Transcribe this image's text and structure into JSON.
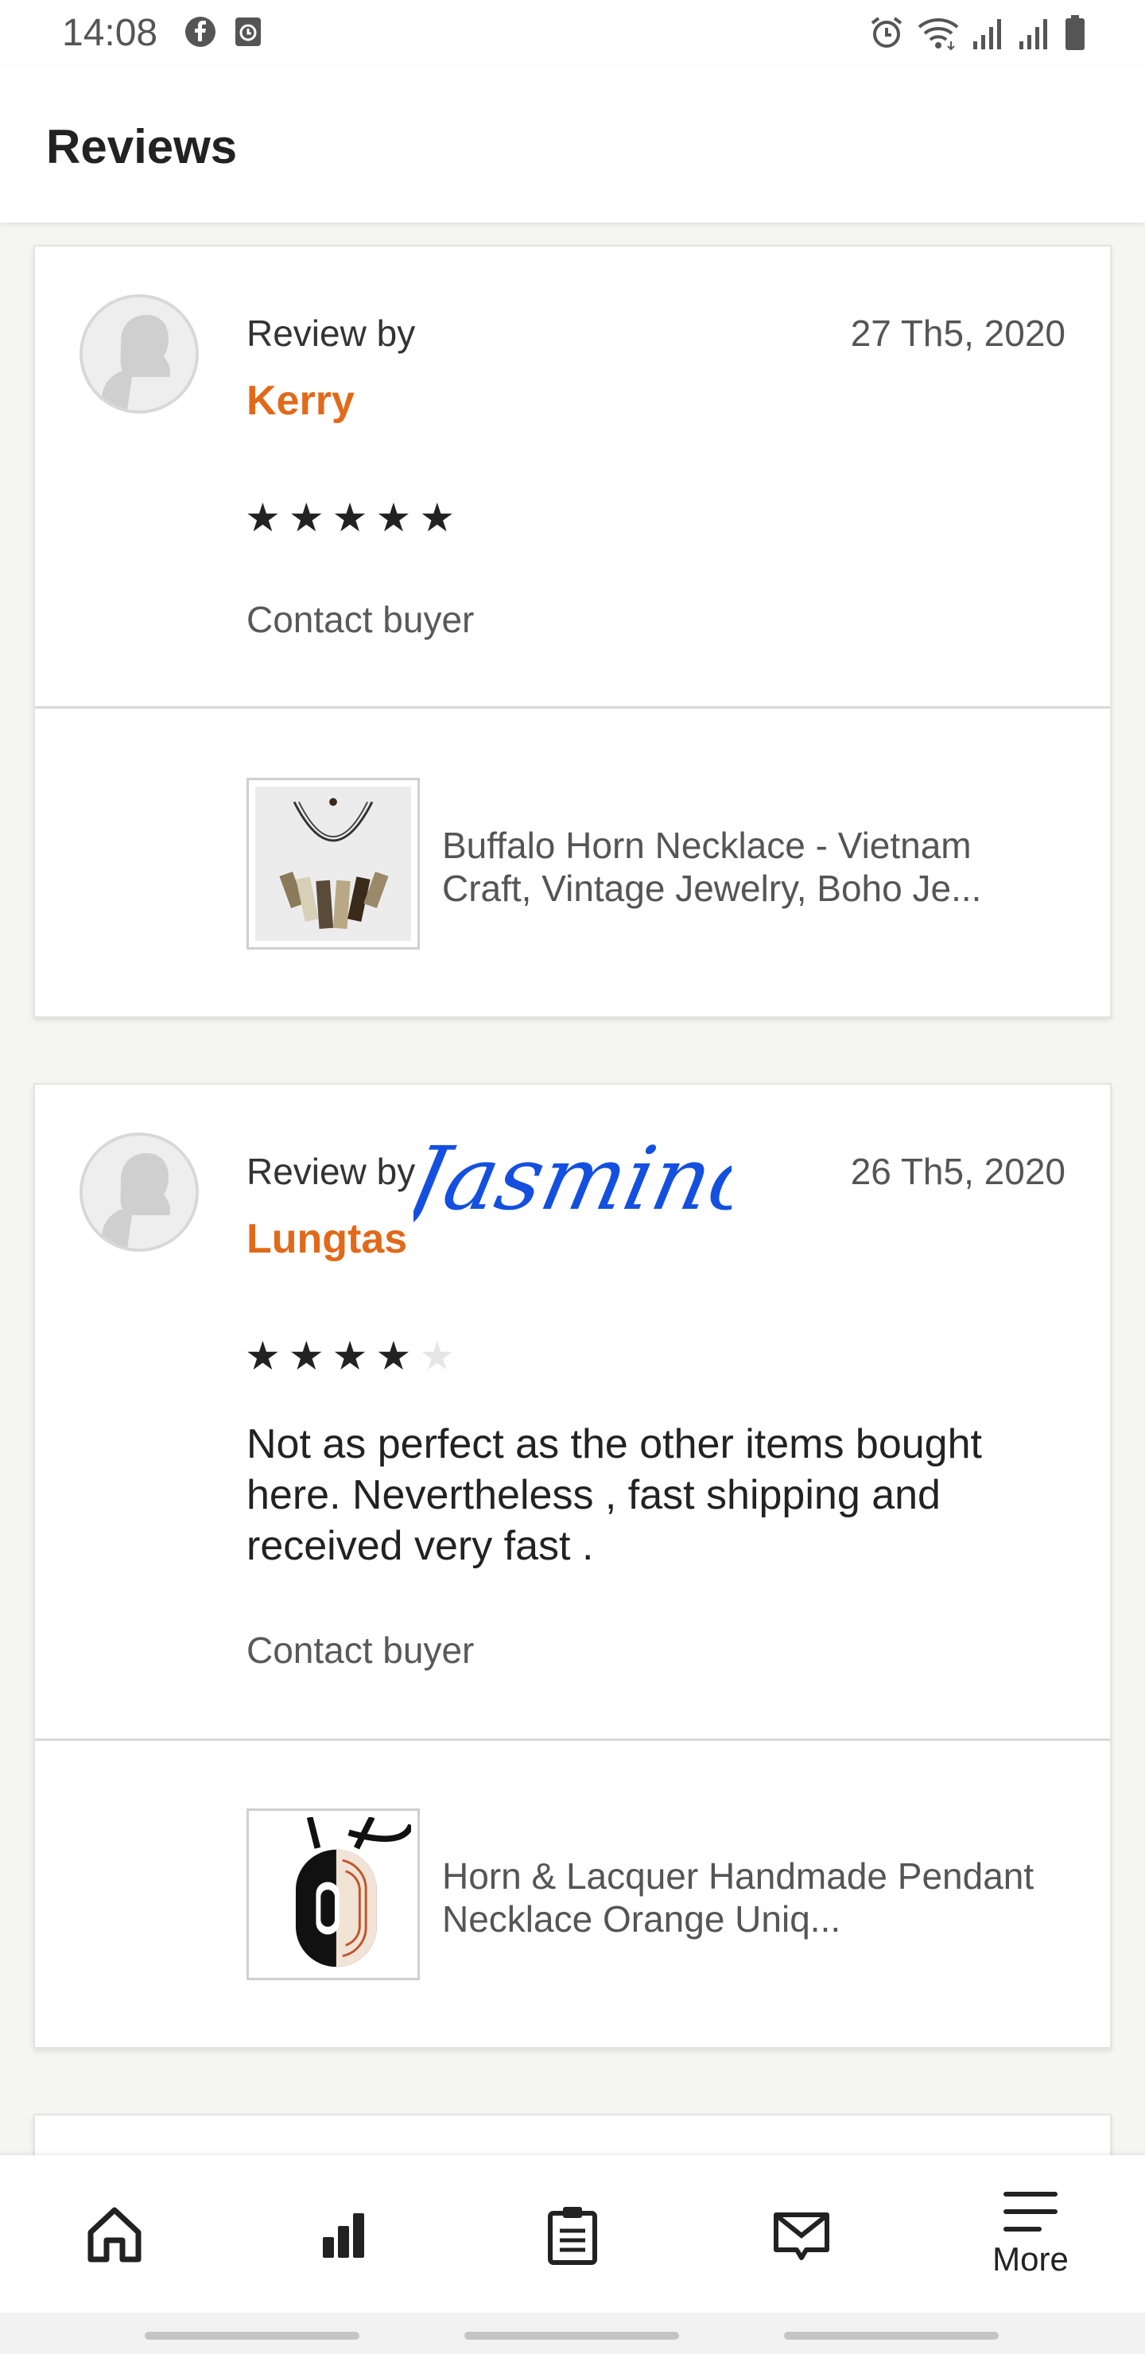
{
  "status_bar": {
    "time": "14:08",
    "left_icons": [
      "facebook-icon",
      "clock-app-icon"
    ],
    "right_icons": [
      "alarm-icon",
      "wifi-icon",
      "signal-icon",
      "signal-icon",
      "battery-icon"
    ]
  },
  "header": {
    "title": "Reviews"
  },
  "reviews": [
    {
      "review_by_label": "Review by",
      "reviewer_name": "Kerry",
      "date": "27 Th5, 2020",
      "rating": 5,
      "stars": [
        "★",
        "★",
        "★",
        "★",
        "★"
      ],
      "text": "",
      "contact_label": "Contact buyer",
      "product_title": "Buffalo Horn Necklace - Vietnam Craft, Vintage Jewelry, Boho Je..."
    },
    {
      "review_by_label": "Review by",
      "reviewer_name": "Lungtas",
      "date": "26 Th5, 2020",
      "rating": 4,
      "stars": [
        "★",
        "★",
        "★",
        "★",
        "★"
      ],
      "text": "Not as perfect as the other items bought here. Nevertheless , fast shipping and received very fast .",
      "contact_label": "Contact buyer",
      "product_title": "Horn & Lacquer Handmade Pendant Necklace Orange Uniq..."
    }
  ],
  "signature_overlay": {
    "text": "Jasmino",
    "color": "#1450e0"
  },
  "bottom_nav": {
    "items": [
      {
        "icon": "home-icon",
        "label": ""
      },
      {
        "icon": "stats-icon",
        "label": ""
      },
      {
        "icon": "orders-clipboard-icon",
        "label": ""
      },
      {
        "icon": "messages-icon",
        "label": ""
      },
      {
        "icon": "menu-icon",
        "label": "More"
      }
    ]
  },
  "colors": {
    "accent": "#e06a1a",
    "background": "#f5f5f1",
    "text": "#222222",
    "muted": "#595959"
  }
}
